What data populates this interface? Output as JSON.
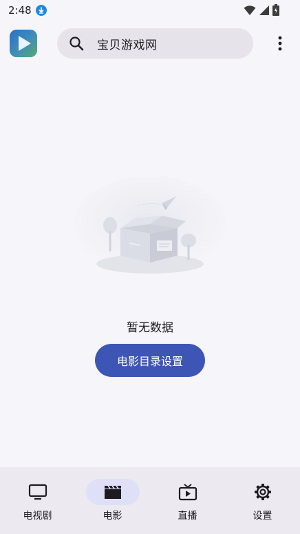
{
  "status_bar": {
    "time": "2:48",
    "icons": [
      "download-icon",
      "wifi-icon",
      "signal-icon",
      "battery-icon"
    ]
  },
  "search": {
    "text": "宝贝游戏网"
  },
  "empty_state": {
    "message": "暂无数据",
    "button_label": "电影目录设置"
  },
  "bottom_nav": {
    "items": [
      {
        "label": "电视剧",
        "icon": "tv-icon"
      },
      {
        "label": "电影",
        "icon": "clapperboard-icon",
        "active": true
      },
      {
        "label": "直播",
        "icon": "live-tv-icon"
      },
      {
        "label": "设置",
        "icon": "gear-icon"
      }
    ]
  },
  "colors": {
    "accent": "#3d55b5",
    "background": "#f6f5fa",
    "nav_background": "#ece9f1",
    "active_indicator": "#dfe0f7",
    "download_badge": "#1e88e5"
  }
}
